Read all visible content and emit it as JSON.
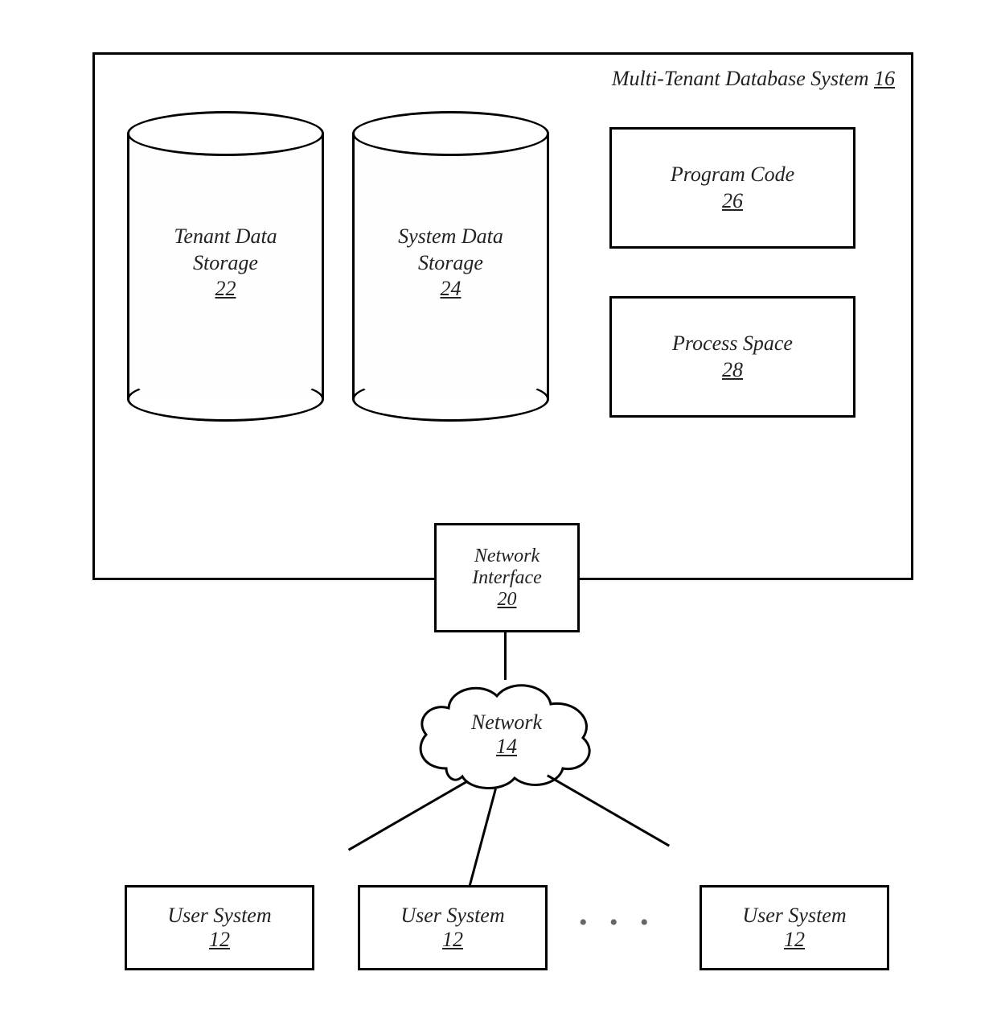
{
  "system": {
    "title_text": "Multi-Tenant Database System",
    "title_ref": "16"
  },
  "cylinders": {
    "tenant": {
      "line1": "Tenant Data",
      "line2": "Storage",
      "ref": "22"
    },
    "system": {
      "line1": "System Data",
      "line2": "Storage",
      "ref": "24"
    }
  },
  "boxes": {
    "code": {
      "label": "Program Code",
      "ref": "26"
    },
    "space": {
      "label": "Process Space",
      "ref": "28"
    },
    "nif": {
      "line1": "Network",
      "line2": "Interface",
      "ref": "20"
    }
  },
  "network": {
    "label": "Network",
    "ref": "14"
  },
  "user_systems": [
    {
      "label": "User System",
      "ref": "12"
    },
    {
      "label": "User System",
      "ref": "12"
    },
    {
      "label": "User System",
      "ref": "12"
    }
  ],
  "ellipsis": "• • •"
}
